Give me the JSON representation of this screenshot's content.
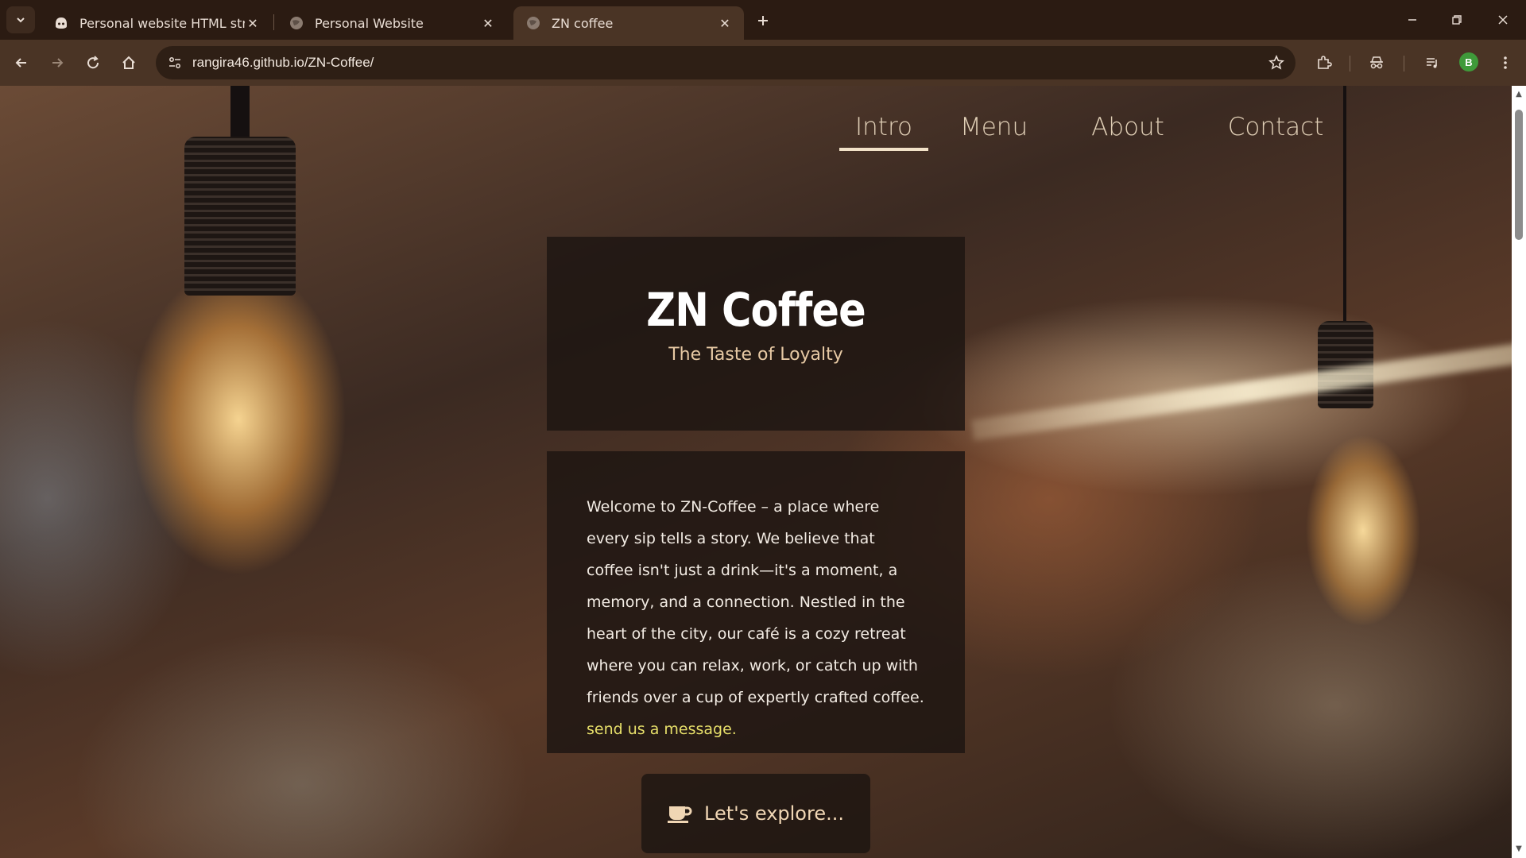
{
  "browser": {
    "tabs": [
      {
        "title": "Personal website HTML structur",
        "favicon": "copilot-icon",
        "active": false
      },
      {
        "title": "Personal Website",
        "favicon": "globe-icon",
        "active": false
      },
      {
        "title": "ZN coffee",
        "favicon": "globe-icon",
        "active": true
      }
    ],
    "url": "rangira46.github.io/ZN-Coffee/",
    "profile_initial": "B",
    "profile_color": "#3f9a3a"
  },
  "site": {
    "nav": [
      "Intro",
      "Menu",
      "About",
      "Contact"
    ],
    "active_nav": "Intro",
    "brand_title": "ZN Coffee",
    "tagline": "The Taste of Loyalty",
    "intro_text": "Welcome to ZN-Coffee – a place where every sip tells a story. We believe that coffee isn't just a drink—it's a moment, a memory, and a connection. Nestled in the heart of the city, our café is a cozy retreat where you can relax, work, or catch up with friends over a cup of expertly crafted coffee.",
    "intro_link": "send us a message.",
    "cta_label": "Let's explore...",
    "cta_icon": "coffee-cup-icon",
    "accent_link_color": "#e7df6a",
    "tagline_color": "#e7c9a4"
  }
}
